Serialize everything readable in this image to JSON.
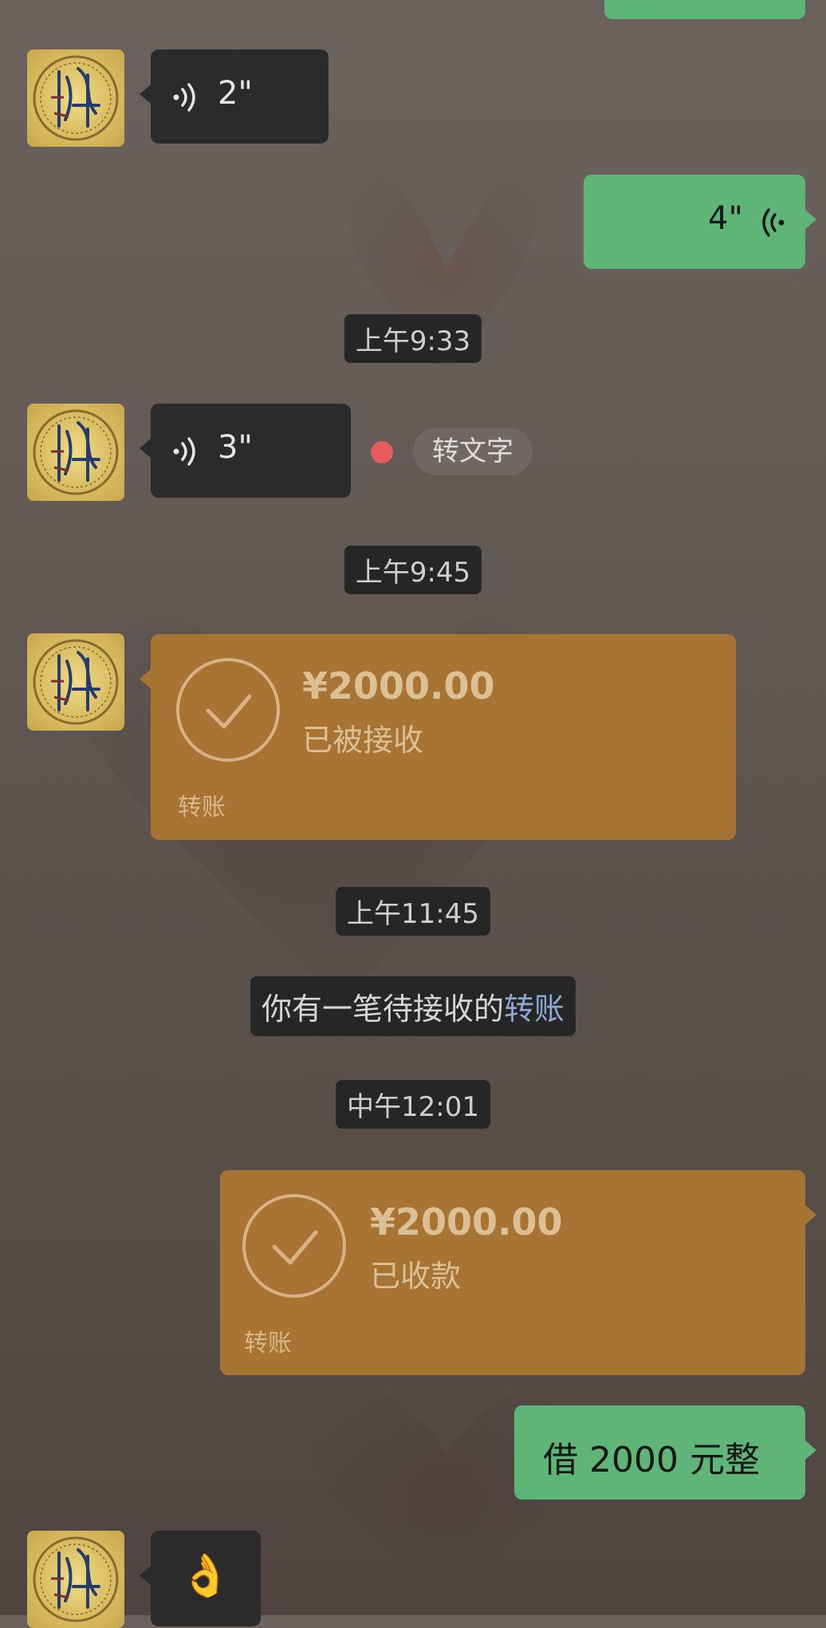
{
  "messages": {
    "voice_received_1": {
      "duration": "2\""
    },
    "voice_sent_1": {
      "duration": "4\""
    },
    "voice_received_2": {
      "duration": "3\"",
      "transcribe_label": "转文字"
    },
    "transfer_received": {
      "amount": "¥2000.00",
      "status": "已被接收",
      "label": "转账"
    },
    "transfer_sent": {
      "amount": "¥2000.00",
      "status": "已收款",
      "label": "转账"
    },
    "text_sent": {
      "text": "借 2000 元整"
    },
    "emoji_received": {
      "emoji": "👌"
    }
  },
  "timestamps": {
    "t1": "上午9:33",
    "t2": "上午9:45",
    "t3": "上午11:45",
    "t4": "中午12:01"
  },
  "system_notice": {
    "prefix": "你有一笔待接收的",
    "link": "转账"
  },
  "colors": {
    "dark_bubble": "#2b2b2b",
    "green_bubble": "#5fb577",
    "transfer_bubble": "#a87434",
    "link": "#8ea9d8",
    "unread_dot": "#e45c5c"
  },
  "icons": {
    "voice_incoming": "voice-wave-icon",
    "voice_outgoing": "voice-wave-icon",
    "transfer_check": "check-circle-icon"
  }
}
